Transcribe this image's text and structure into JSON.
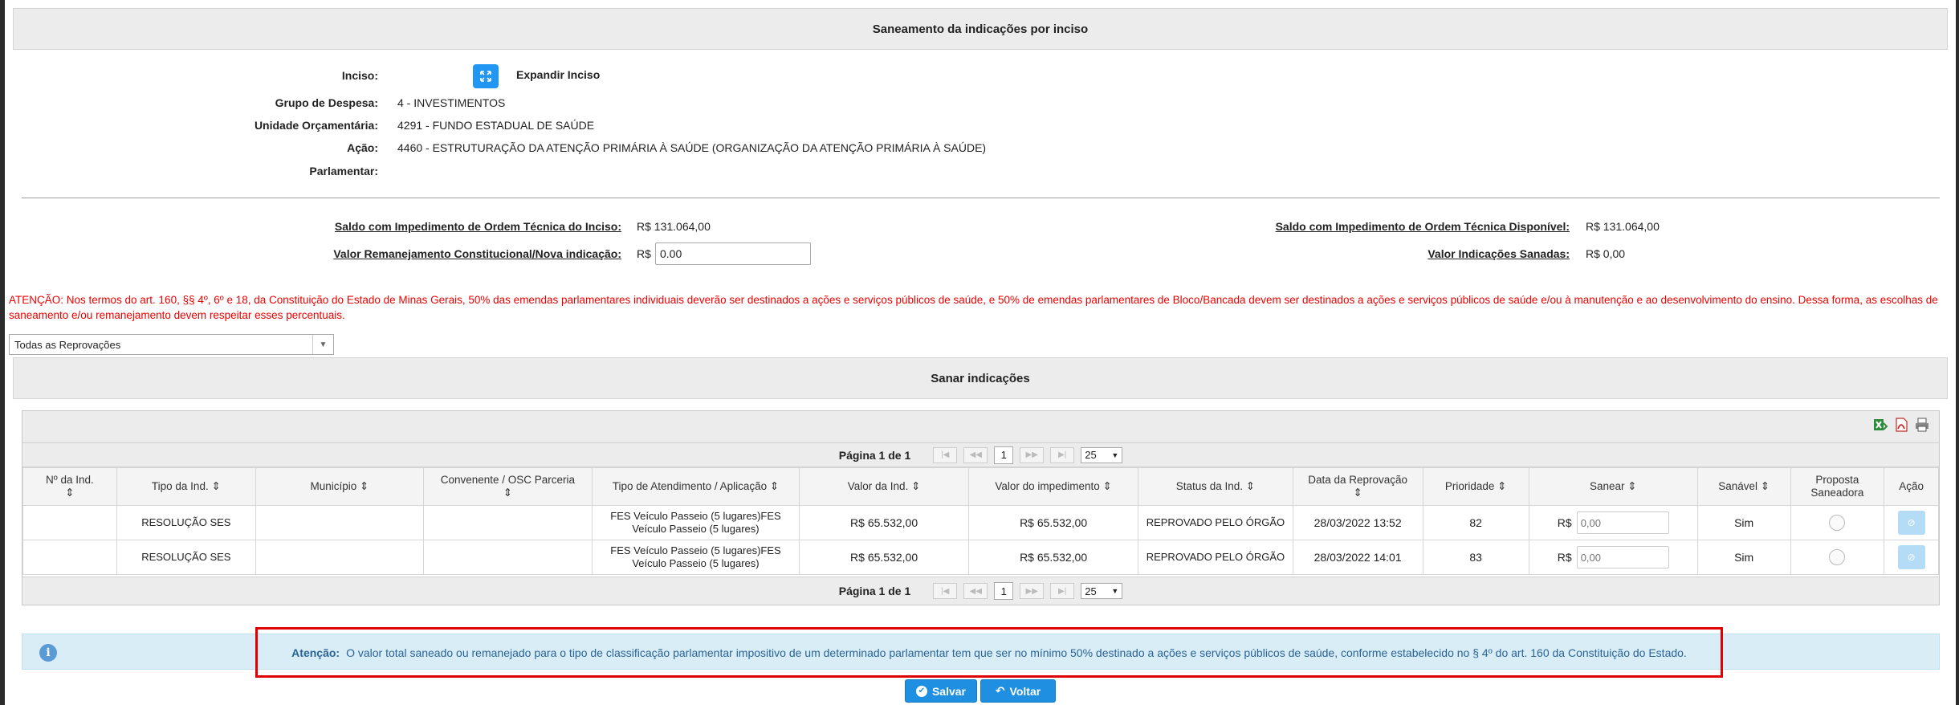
{
  "header": {
    "title": "Saneamento da indicações por inciso"
  },
  "info": {
    "inciso_label": "Inciso:",
    "expand_button": "Expandir Inciso",
    "grupo_label": "Grupo de Despesa:",
    "grupo_value": "4 - INVESTIMENTOS",
    "unidade_label": "Unidade Orçamentária:",
    "unidade_value": "4291 - FUNDO ESTADUAL DE SAÚDE",
    "acao_label": "Ação:",
    "acao_value": "4460 - ESTRUTURAÇÃO DA ATENÇÃO PRIMÁRIA À SAÚDE (ORGANIZAÇÃO DA ATENÇÃO PRIMÁRIA À SAÚDE)",
    "parlamentar_label": "Parlamentar:"
  },
  "balances": {
    "saldo_inciso_label": "Saldo com Impedimento de Ordem Técnica do Inciso:",
    "saldo_inciso_value": "R$ 131.064,00",
    "saldo_disponivel_label": "Saldo com Impedimento de Ordem Técnica Disponível:",
    "saldo_disponivel_value": "R$ 131.064,00",
    "valor_remanejamento_label": "Valor Remanejamento Constitucional/Nova indicação:",
    "currency": "R$",
    "valor_remanejamento_value": "0.00",
    "valor_sanadas_label": "Valor Indicações Sanadas:",
    "valor_sanadas_value": "R$ 0,00"
  },
  "warning": "ATENÇÃO: Nos termos do art. 160, §§ 4º, 6º e 18, da Constituição do Estado de Minas Gerais, 50% das emendas parlamentares individuais deverão ser destinados a ações e serviços públicos de saúde, e 50% de emendas parlamentares de Bloco/Bancada devem ser destinados a ações e serviços públicos de saúde e/ou à manutenção e ao desenvolvimento do ensino. Dessa forma, as escolhas de saneamento e/ou remanejamento devem respeitar esses percentuais.",
  "filter": {
    "selected": "Todas as Reprovações"
  },
  "section2": {
    "title": "Sanar indicações"
  },
  "pager": {
    "text": "Página 1 de 1",
    "page": "1",
    "page_size": "25"
  },
  "table": {
    "columns": [
      "Nº da Ind.",
      "Tipo da Ind.",
      "Município",
      "Convenente / OSC Parceria",
      "Tipo de Atendimento / Aplicação",
      "Valor da Ind.",
      "Valor do impedimento",
      "Status da Ind.",
      "Data da Reprovação",
      "Prioridade",
      "Sanear",
      "Sanável",
      "Proposta Saneadora",
      "Ação"
    ],
    "rows": [
      {
        "num": "",
        "tipo": "RESOLUÇÃO SES",
        "municipio": "",
        "convenente": "",
        "atendimento": "FES Veículo Passeio (5 lugares)FES Veículo Passeio (5 lugares)",
        "valor": "R$ 65.532,00",
        "impedimento": "R$ 65.532,00",
        "status": "REPROVADO PELO ÓRGÃO",
        "data": "28/03/2022 13:52",
        "prioridade": "82",
        "sanear_currency": "R$",
        "sanear_placeholder": "0,00",
        "sanavel": "Sim"
      },
      {
        "num": "",
        "tipo": "RESOLUÇÃO SES",
        "municipio": "",
        "convenente": "",
        "atendimento": "FES Veículo Passeio (5 lugares)FES Veículo Passeio (5 lugares)",
        "valor": "R$ 65.532,00",
        "impedimento": "R$ 65.532,00",
        "status": "REPROVADO PELO ÓRGÃO",
        "data": "28/03/2022 14:01",
        "prioridade": "83",
        "sanear_currency": "R$",
        "sanear_placeholder": "0,00",
        "sanavel": "Sim"
      }
    ]
  },
  "notice": {
    "label": "Atenção:",
    "text": "O valor total saneado ou remanejado para o tipo de classificação parlamentar impositivo de um determinado parlamentar tem que ser no mínimo 50% destinado a ações e serviços públicos de saúde, conforme estabelecido no § 4º do art. 160 da Constituição do Estado."
  },
  "actions": {
    "save": "Salvar",
    "back": "Voltar"
  },
  "colors": {
    "primary": "#1e8fe1",
    "warning": "#ee0000",
    "status": "#1a2fcf",
    "info_bg": "#d9edf7",
    "highlight": "#e00000"
  }
}
